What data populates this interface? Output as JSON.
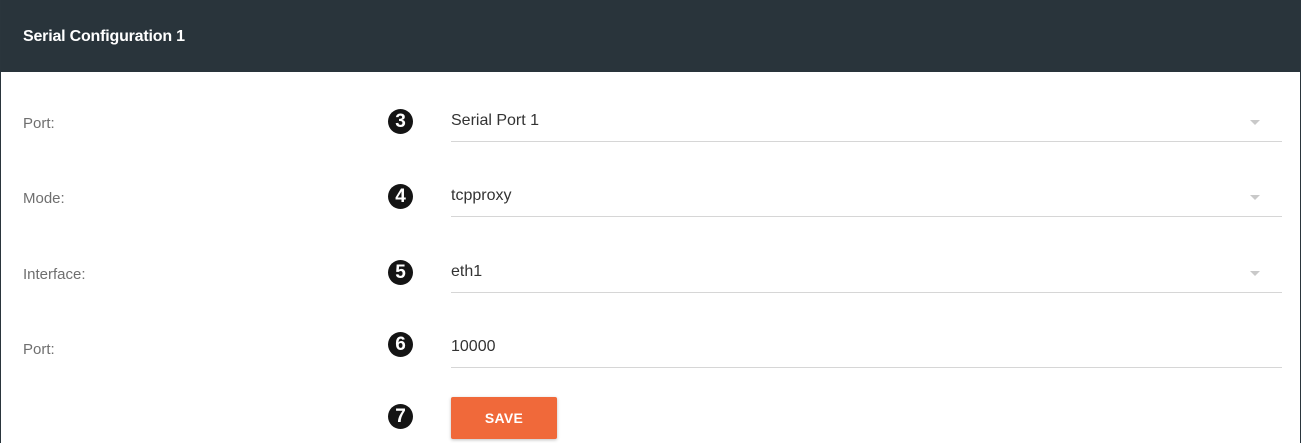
{
  "panel": {
    "title": "Serial Configuration 1"
  },
  "rows": [
    {
      "label": "Port:",
      "step": "3",
      "value": "Serial Port 1",
      "type": "select"
    },
    {
      "label": "Mode:",
      "step": "4",
      "value": "tcpproxy",
      "type": "select"
    },
    {
      "label": "Interface:",
      "step": "5",
      "value": "eth1",
      "type": "select"
    },
    {
      "label": "Port:",
      "step": "6",
      "value": "10000",
      "type": "text-input"
    }
  ],
  "save": {
    "step": "7",
    "label": "SAVE"
  },
  "icons": {
    "dropdown": "caret-down-icon"
  },
  "colors": {
    "header_bg": "#29343b",
    "accent_button": "#f0693a",
    "step_badge": "#141414"
  }
}
